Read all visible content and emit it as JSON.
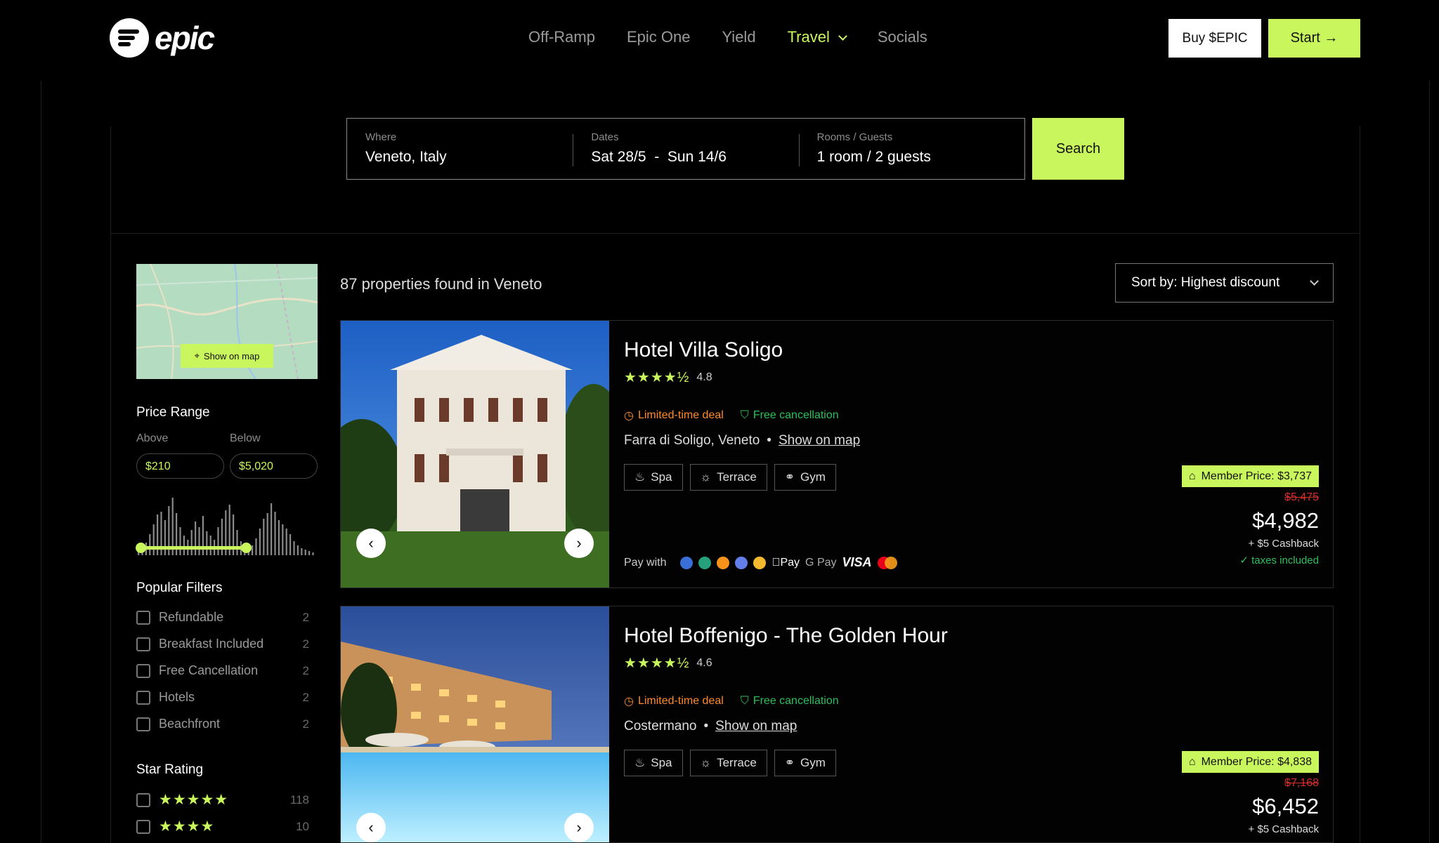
{
  "brand": {
    "name": "epic"
  },
  "nav": {
    "items": [
      "Off-Ramp",
      "Epic One",
      "Yield",
      "Travel",
      "Socials"
    ],
    "active": "Travel"
  },
  "header": {
    "buy_label": "Buy $EPIC",
    "start_label": "Start →"
  },
  "search": {
    "where_label": "Where",
    "where_value": "Veneto, Italy",
    "dates_label": "Dates",
    "dates_value": "Sat 28/5  -  Sun 14/6",
    "guests_label": "Rooms / Guests",
    "guests_value": "1 room / 2 guests",
    "button": "Search"
  },
  "sidebar": {
    "map_button": "Show on map",
    "price_range": {
      "title": "Price Range",
      "above_label": "Above",
      "below_label": "Below",
      "above_value": "$210",
      "below_value": "$5,020"
    },
    "popular_filters": {
      "title": "Popular Filters",
      "items": [
        {
          "label": "Refundable",
          "count": "2"
        },
        {
          "label": "Breakfast Included",
          "count": "2"
        },
        {
          "label": "Free Cancellation",
          "count": "2"
        },
        {
          "label": "Hotels",
          "count": "2"
        },
        {
          "label": "Beachfront",
          "count": "2"
        }
      ]
    },
    "star_rating": {
      "title": "Star Rating",
      "items": [
        {
          "stars": "★★★★★",
          "count": "118"
        },
        {
          "stars": "★★★★",
          "count": "10"
        }
      ]
    }
  },
  "results": {
    "found_text": "87 properties found in Veneto",
    "sort_label": "Sort by: Highest discount",
    "hotels": [
      {
        "name": "Hotel Villa Soligo",
        "stars": "★★★★½",
        "rating": "4.8",
        "deal": "Limited-time deal",
        "cancellation": "Free cancellation",
        "location": "Farra di Soligo, Veneto",
        "map_link": "Show on map",
        "amenities": [
          "Spa",
          "Terrace",
          "Gym"
        ],
        "pay_with": "Pay with",
        "apple_pay": "Pay",
        "google_pay": "G Pay",
        "visa": "VISA",
        "member_price": "Member Price: $3,737",
        "old_price": "$5,475",
        "price": "$4,982",
        "cashback": "+ $5 Cashback",
        "taxes": "taxes included"
      },
      {
        "name": "Hotel Boffenigo - The Golden Hour",
        "stars": "★★★★½",
        "rating": "4.6",
        "deal": "Limited-time deal",
        "cancellation": "Free cancellation",
        "location": "Costermano",
        "map_link": "Show on map",
        "amenities": [
          "Spa",
          "Terrace",
          "Gym"
        ],
        "member_price": "Member Price: $4,838",
        "old_price": "$7,168",
        "price": "$6,452",
        "cashback": "+ $5 Cashback"
      }
    ]
  },
  "colors": {
    "accent": "#c8f65c",
    "deal": "#ff8a2a",
    "ok": "#2fbf5a",
    "strike": "#d62c2c"
  }
}
